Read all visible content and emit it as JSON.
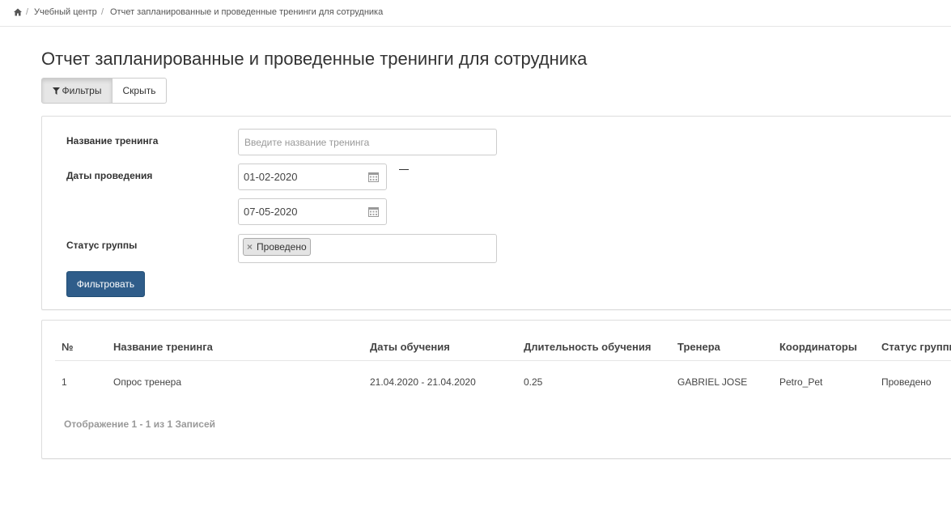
{
  "breadcrumb": {
    "home_icon": "home-icon",
    "separator": "/",
    "items": [
      "Учебный центр",
      "Отчет запланированные и проведенные тренинги для сотрудника"
    ]
  },
  "page": {
    "title": "Отчет запланированные и проведенные тренинги для сотрудника"
  },
  "toolbar": {
    "filters_label": "Фильтры",
    "filters_icon": "filter-icon",
    "hide_label": "Скрыть"
  },
  "filters": {
    "training_name": {
      "label": "Название тренинга",
      "placeholder": "Введите название тренинга",
      "value": ""
    },
    "dates": {
      "label": "Даты проведения",
      "from": "01-02-2020",
      "to": "07-05-2020",
      "separator": "—",
      "icon": "calendar-icon"
    },
    "group_status": {
      "label": "Статус группы",
      "selected": [
        "Проведено"
      ],
      "remove_symbol": "×"
    },
    "submit_label": "Фильтровать"
  },
  "table": {
    "columns": [
      "№",
      "Название тренинга",
      "Даты обучения",
      "Длительность обучения",
      "Тренера",
      "Координаторы",
      "Статус группы"
    ],
    "rows": [
      {
        "num": "1",
        "name": "Опрос тренера",
        "dates": "21.04.2020 - 21.04.2020",
        "duration": "0.25",
        "trainer": "GABRIEL JOSE",
        "coordinators": "Petro_Pet",
        "status": "Проведено"
      }
    ],
    "info": "Отображение 1 - 1 из 1 Записей"
  },
  "colors": {
    "primary_button": "#2f5d8a",
    "border": "#dddddd",
    "text": "#333333",
    "muted": "#999999"
  }
}
